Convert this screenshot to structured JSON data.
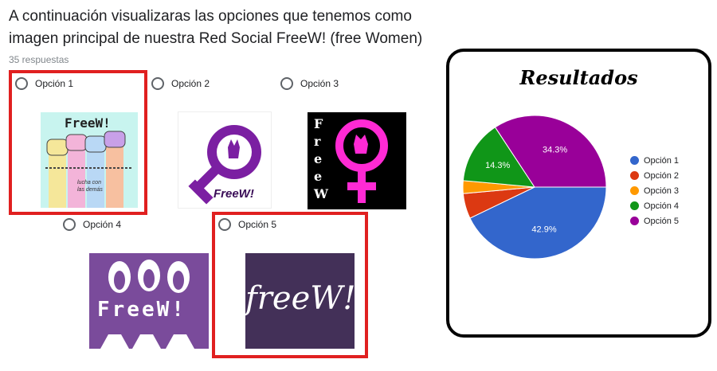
{
  "question": {
    "title": "A continuación visualizaras las opciones que tenemos como imagen principal de nuestra Red Social FreeW! (free Women)",
    "responses": "35 respuestas"
  },
  "options": [
    {
      "label": "Opción 1",
      "image_text": "FreeW!",
      "image_caption": "lucha con las demás",
      "selected_highlight": true
    },
    {
      "label": "Opción 2",
      "image_text": "FreeW!",
      "selected_highlight": false
    },
    {
      "label": "Opción 3",
      "image_text": "FreeW",
      "selected_highlight": false
    },
    {
      "label": "Opción 4",
      "image_text": "FreeW!",
      "selected_highlight": false
    },
    {
      "label": "Opción 5",
      "image_text": "freeW!",
      "selected_highlight": true
    }
  ],
  "results": {
    "title": "Resultados",
    "legend": [
      {
        "label": "Opción 1",
        "color": "#3366cc"
      },
      {
        "label": "Opción 2",
        "color": "#dc3912"
      },
      {
        "label": "Opción 3",
        "color": "#ff9900"
      },
      {
        "label": "Opción 4",
        "color": "#109618"
      },
      {
        "label": "Opción 5",
        "color": "#990099"
      }
    ]
  },
  "chart_data": {
    "type": "pie",
    "title": "Resultados",
    "categories": [
      "Opción 1",
      "Opción 2",
      "Opción 3",
      "Opción 4",
      "Opción 5"
    ],
    "values": [
      42.9,
      5.7,
      2.9,
      14.3,
      34.3
    ],
    "value_labels": [
      "42.9%",
      "",
      "",
      "14.3%",
      "34.3%"
    ],
    "colors": [
      "#3366cc",
      "#dc3912",
      "#ff9900",
      "#109618",
      "#990099"
    ],
    "legend_position": "right"
  },
  "colors": {
    "highlight": "#e02020",
    "option2_purple": "#7b1fa2",
    "option3_pink": "#ff2ad4",
    "option4_purple": "#7a4b9b",
    "option5_purple": "#433058"
  }
}
